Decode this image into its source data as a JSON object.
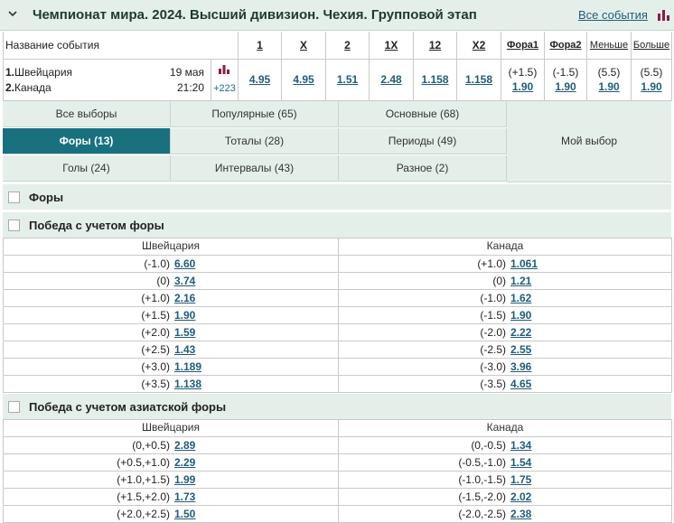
{
  "header": {
    "title": "Чемпионат мира. 2024. Высший дивизион. Чехия. Групповой этап",
    "all_events": "Все события"
  },
  "event": {
    "name_header": "Название события",
    "team1": "Швейцария",
    "team2": "Канада",
    "team1_num": "1.",
    "team2_num": "2.",
    "date": "19 мая",
    "time": "21:20",
    "more": "+223"
  },
  "columns": [
    "1",
    "X",
    "2",
    "1X",
    "12",
    "X2",
    "Фора1",
    "Фора2",
    "Меньше",
    "Больше"
  ],
  "main_odds": [
    "4.95",
    "4.95",
    "1.51",
    "2.48",
    "1.158",
    "1.158"
  ],
  "extra_odds": [
    {
      "param": "(+1.5)",
      "value": "1.90"
    },
    {
      "param": "(-1.5)",
      "value": "1.90"
    },
    {
      "param": "(5.5)",
      "value": "1.90"
    },
    {
      "param": "(5.5)",
      "value": "1.90"
    }
  ],
  "tabs": {
    "all": "Все выборы",
    "popular": "Популярные (65)",
    "main": "Основные (68)",
    "handicaps": "Форы (13)",
    "totals": "Тоталы (28)",
    "periods": "Периоды (49)",
    "my_choice": "Мой выбор",
    "goals": "Голы (24)",
    "intervals": "Интервалы (43)",
    "misc": "Разное (2)"
  },
  "sections": {
    "handicaps": "Форы",
    "handicap_win": "Победа с учетом форы",
    "asian_handicap_win": "Победа с учетом азиатской форы"
  },
  "handicap_table": {
    "col1": "Швейцария",
    "col2": "Канада",
    "rows": [
      {
        "l_param": "(-1.0)",
        "l_odd": "6.60",
        "r_param": "(+1.0)",
        "r_odd": "1.061"
      },
      {
        "l_param": "(0)",
        "l_odd": "3.74",
        "r_param": "(0)",
        "r_odd": "1.21"
      },
      {
        "l_param": "(+1.0)",
        "l_odd": "2.16",
        "r_param": "(-1.0)",
        "r_odd": "1.62"
      },
      {
        "l_param": "(+1.5)",
        "l_odd": "1.90",
        "r_param": "(-1.5)",
        "r_odd": "1.90"
      },
      {
        "l_param": "(+2.0)",
        "l_odd": "1.59",
        "r_param": "(-2.0)",
        "r_odd": "2.22"
      },
      {
        "l_param": "(+2.5)",
        "l_odd": "1.43",
        "r_param": "(-2.5)",
        "r_odd": "2.55"
      },
      {
        "l_param": "(+3.0)",
        "l_odd": "1.189",
        "r_param": "(-3.0)",
        "r_odd": "3.96"
      },
      {
        "l_param": "(+3.5)",
        "l_odd": "1.138",
        "r_param": "(-3.5)",
        "r_odd": "4.65"
      }
    ]
  },
  "asian_table": {
    "col1": "Швейцария",
    "col2": "Канада",
    "rows": [
      {
        "l_param": "(0,+0.5)",
        "l_odd": "2.89",
        "r_param": "(0,-0.5)",
        "r_odd": "1.34"
      },
      {
        "l_param": "(+0.5,+1.0)",
        "l_odd": "2.29",
        "r_param": "(-0.5,-1.0)",
        "r_odd": "1.54"
      },
      {
        "l_param": "(+1.0,+1.5)",
        "l_odd": "1.99",
        "r_param": "(-1.0,-1.5)",
        "r_odd": "1.75"
      },
      {
        "l_param": "(+1.5,+2.0)",
        "l_odd": "1.73",
        "r_param": "(-1.5,-2.0)",
        "r_odd": "2.02"
      },
      {
        "l_param": "(+2.0,+2.5)",
        "l_odd": "1.50",
        "r_param": "(-2.0,-2.5)",
        "r_odd": "2.38"
      }
    ]
  },
  "colors": {
    "accent": "#19707f",
    "header_bg": "#e4efea",
    "link": "#1f5d78",
    "chart_icon": "#8b1c4a"
  }
}
